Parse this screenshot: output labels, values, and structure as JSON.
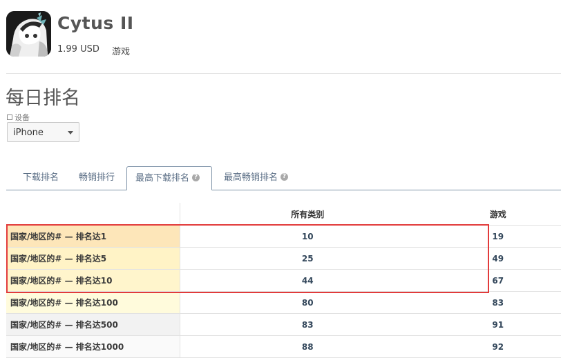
{
  "app": {
    "name": "Cytus II",
    "price": "1.99 USD",
    "genre": "游戏",
    "icon": "app-artwork-icon"
  },
  "section": {
    "title": "每日排名",
    "device_label": "设备",
    "device_value": "iPhone"
  },
  "tabs": [
    {
      "label": "下载排名",
      "active": false,
      "help": false
    },
    {
      "label": "畅销排行",
      "active": false,
      "help": false
    },
    {
      "label": "最高下载排名",
      "active": true,
      "help": true
    },
    {
      "label": "最高畅销排名",
      "active": false,
      "help": true
    }
  ],
  "table": {
    "columns": [
      "所有类别",
      "游戏"
    ],
    "rows": [
      {
        "label": "国家/地区的# — 排名达1",
        "values": [
          "10",
          "19"
        ],
        "bg": "#fde6b9"
      },
      {
        "label": "国家/地区的# — 排名达5",
        "values": [
          "25",
          "49"
        ],
        "bg": "#fff3c6"
      },
      {
        "label": "国家/地区的# — 排名达10",
        "values": [
          "44",
          "67"
        ],
        "bg": "#fff5cc"
      },
      {
        "label": "国家/地区的# — 排名达100",
        "values": [
          "80",
          "83"
        ],
        "bg": "#fffbdc"
      },
      {
        "label": "国家/地区的# — 排名达500",
        "values": [
          "83",
          "91"
        ],
        "bg": "#f2f2f2"
      },
      {
        "label": "国家/地区的# — 排名达1000",
        "values": [
          "88",
          "92"
        ],
        "bg": "#fafafa"
      }
    ]
  },
  "colors": {
    "accent": "#7e93a8",
    "highlight": "#e23b3b"
  }
}
